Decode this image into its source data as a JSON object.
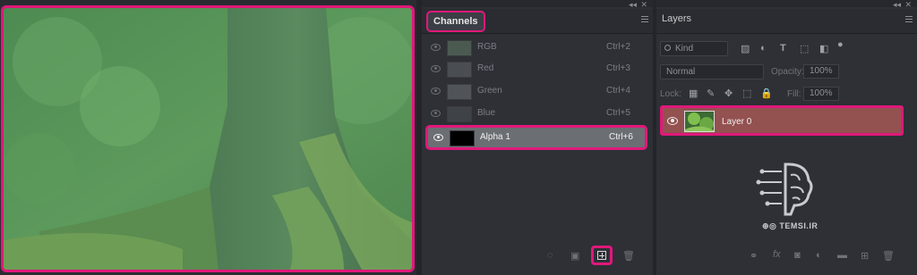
{
  "channels_panel": {
    "title": "Channels",
    "channels": [
      {
        "name": "RGB",
        "shortcut": "Ctrl+2"
      },
      {
        "name": "Red",
        "shortcut": "Ctrl+3"
      },
      {
        "name": "Green",
        "shortcut": "Ctrl+4"
      },
      {
        "name": "Blue",
        "shortcut": "Ctrl+5"
      },
      {
        "name": "Alpha 1",
        "shortcut": "Ctrl+6"
      }
    ],
    "bottom_icons": [
      "load-selection-icon",
      "save-selection-icon",
      "new-channel-icon",
      "delete-channel-icon"
    ]
  },
  "layers_panel": {
    "title": "Layers",
    "filter": {
      "kind_label": "Kind"
    },
    "blend_mode": "Normal",
    "opacity_label": "Opacity:",
    "opacity_value": "100%",
    "lock_label": "Lock:",
    "fill_label": "Fill:",
    "fill_value": "100%",
    "layers": [
      {
        "name": "Layer 0"
      }
    ],
    "watermark": "TEMSI.IR",
    "bottom_icons": [
      "link-icon",
      "fx-icon",
      "mask-icon",
      "adjustment-icon",
      "group-icon",
      "new-layer-icon",
      "delete-icon"
    ]
  },
  "colors": {
    "highlight": "#e0187a",
    "selected_layer": "#935150",
    "panel_bg": "#2e3036"
  }
}
